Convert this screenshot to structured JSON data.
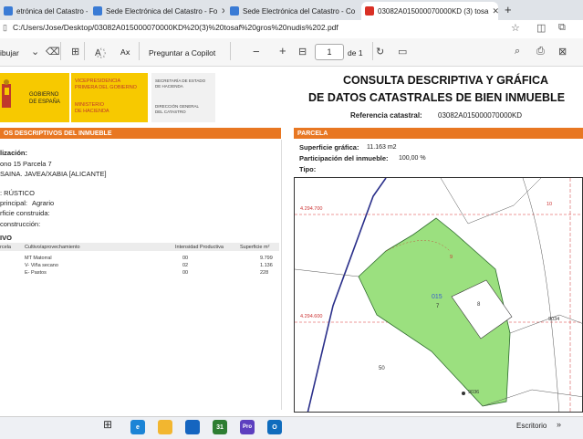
{
  "browser": {
    "tabs": [
      {
        "label": "etrónica del Catastro - Co",
        "color": "#3a7bd5"
      },
      {
        "label": "Sede Electrónica del Catastro - Fo",
        "color": "#3a7bd5"
      },
      {
        "label": "Sede Electrónica del Catastro - Co",
        "color": "#3a7bd5"
      },
      {
        "label": "03082A015000070000KD (3) tosa",
        "color": "#d93025"
      }
    ],
    "new_tab": "+",
    "url": "C:/Users/Jose/Desktop/03082A015000070000KD%20(3)%20tosaf%20gros%20nudis%202.pdf"
  },
  "pdf_toolbar": {
    "highlight": "ibujar",
    "ai_label": "Aⅹ",
    "copilot": "Preguntar a Copilot",
    "minus": "−",
    "plus": "+",
    "page_value": "1",
    "page_of": "de 1"
  },
  "header": {
    "org_gobierno": "GOBIERNO\nDE ESPAÑA",
    "org_vice": "VICEPRESIDENCIA\nPRIMERA DEL GOBIERNO",
    "org_ministerio": "MINISTERIO\nDE HACIENDA",
    "org_secretaria": "SECRETARÍA DE ESTADO\nDE HACIENDA",
    "org_direccion": "DIRECCIÓN GENERAL\nDEL CATASTRO",
    "title_line1": "CONSULTA DESCRIPTIVA Y GRÁFICA",
    "title_line2": "DE DATOS CATASTRALES DE BIEN INMUEBLE",
    "ref_label": "Referencia catastral:",
    "ref_value": "03082A015000070000KD"
  },
  "left": {
    "section_title": "OS DESCRIPTIVOS DEL INMUEBLE",
    "localizacion_label": "lización:",
    "localizacion_line1": "ono 15 Parcela 7",
    "localizacion_line2": "SAINA. JAVEA/XABIA [ALICANTE]",
    "clase": ": RÚSTICO",
    "uso_label": "principal:",
    "uso_value": "Agrario",
    "superficie": "rficie construida:",
    "anio": "construcción:",
    "cultivo": "IVO",
    "table_headers": [
      "rcela",
      "Cultivo/aprovechamiento",
      "Intensidad Productiva",
      "Superficie m²"
    ],
    "table_rows": [
      [
        "",
        "MT Matorral",
        "00",
        "9.799"
      ],
      [
        "",
        "V- Viña secano",
        "02",
        "1.136"
      ],
      [
        "",
        "E- Pastos",
        "00",
        "228"
      ]
    ]
  },
  "right": {
    "section_title": "PARCELA",
    "sup_label": "Superficie gráfica:",
    "sup_value": "11.163 m2",
    "part_label": "Participación del inmueble:",
    "part_value": "100,00 %",
    "tipo_label": "Tipo:",
    "map_labels": {
      "coord1": "4.294.700",
      "coord2": "4.294.600",
      "parcel_num": "015",
      "parcel_sub": "7",
      "n50": "50",
      "n8": "8",
      "n9034": "9034",
      "n10": "10",
      "n9": "9",
      "n9036": "9036"
    }
  },
  "taskbar": {
    "desktop_label": "Escritorio",
    "icons": [
      {
        "name": "edge",
        "text": "e",
        "color": "#1b84d6"
      },
      {
        "name": "files",
        "text": "",
        "color": "#f2b630"
      },
      {
        "name": "mail",
        "text": "",
        "color": "#1565c0"
      },
      {
        "name": "calendar",
        "text": "31",
        "color": "#2e7d32"
      },
      {
        "name": "project",
        "text": "Pro",
        "color": "#5c3fbf"
      },
      {
        "name": "outlook",
        "text": "O",
        "color": "#0f6cbd"
      }
    ]
  }
}
